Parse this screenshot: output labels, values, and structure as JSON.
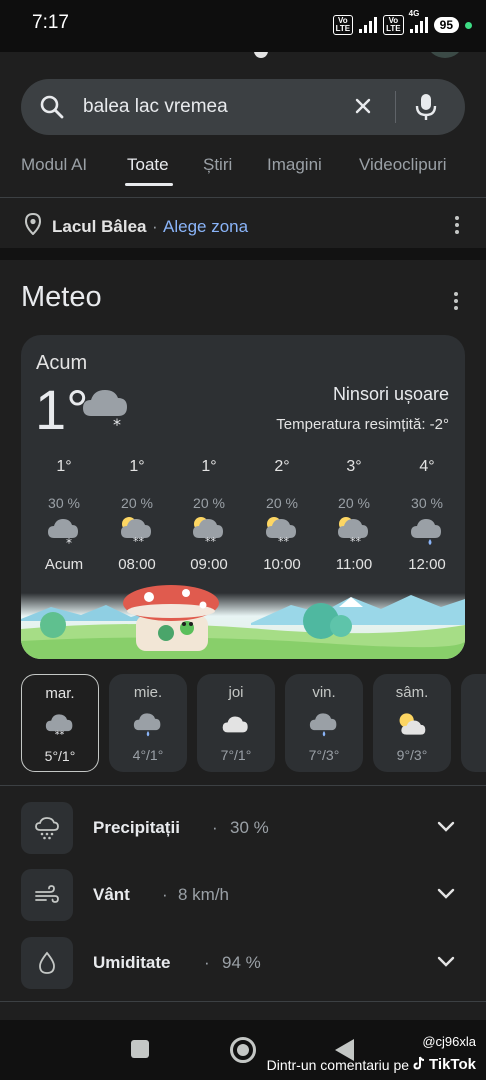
{
  "status_bar": {
    "time": "7:17",
    "volte1": "Vo LTE",
    "volte2": "Vo LTE",
    "net_type": "4G",
    "battery": "95"
  },
  "search": {
    "query": "balea lac vremea"
  },
  "tabs": [
    "Modul AI",
    "Toate",
    "Știri",
    "Imagini",
    "Videoclipuri"
  ],
  "active_tab": "Toate",
  "location": {
    "name": "Lacul Bâlea",
    "separator": "·",
    "link": "Alege zona"
  },
  "weather": {
    "section_title": "Meteo",
    "now_label": "Acum",
    "current_temp": "1°",
    "condition": "Ninsori ușoare",
    "feels_like": "Temperatura resimțită: -2°",
    "hourly": [
      {
        "temp": "1°",
        "precip": "30 %",
        "icon": "snow-cloud-icon",
        "time": "Acum"
      },
      {
        "temp": "1°",
        "precip": "20 %",
        "icon": "sun-snow-cloud-icon",
        "time": "08:00"
      },
      {
        "temp": "1°",
        "precip": "20 %",
        "icon": "sun-snow-cloud-icon",
        "time": "09:00"
      },
      {
        "temp": "2°",
        "precip": "20 %",
        "icon": "sun-snow-cloud-icon",
        "time": "10:00"
      },
      {
        "temp": "3°",
        "precip": "20 %",
        "icon": "sun-snow-cloud-icon",
        "time": "11:00"
      },
      {
        "temp": "4°",
        "precip": "30 %",
        "icon": "rain-cloud-icon",
        "time": "12:00"
      }
    ],
    "days": [
      {
        "name": "mar.",
        "icon": "snow-cloud-icon",
        "range": "5°/1°",
        "selected": true
      },
      {
        "name": "mie.",
        "icon": "rain-cloud-icon",
        "range": "4°/1°",
        "selected": false
      },
      {
        "name": "joi",
        "icon": "cloud-icon",
        "range": "7°/1°",
        "selected": false
      },
      {
        "name": "vin.",
        "icon": "rain-cloud-icon",
        "range": "7°/3°",
        "selected": false
      },
      {
        "name": "sâm.",
        "icon": "partly-sunny-icon",
        "range": "9°/3°",
        "selected": false
      }
    ],
    "details": [
      {
        "label": "Precipitații",
        "value": "30 %",
        "icon": "precipitation-icon"
      },
      {
        "label": "Vânt",
        "value": "8 km/h",
        "icon": "wind-icon"
      },
      {
        "label": "Umiditate",
        "value": "94 %",
        "icon": "humidity-drop-icon"
      }
    ]
  },
  "watermark": {
    "user": "@cj96xla",
    "text": "Dintr-un comentariu pe",
    "brand": "TikTok"
  },
  "colors": {
    "background": "#1f1f1f",
    "card": "#2d3033",
    "link": "#8ab4f8",
    "search_bar": "#3c4043"
  }
}
